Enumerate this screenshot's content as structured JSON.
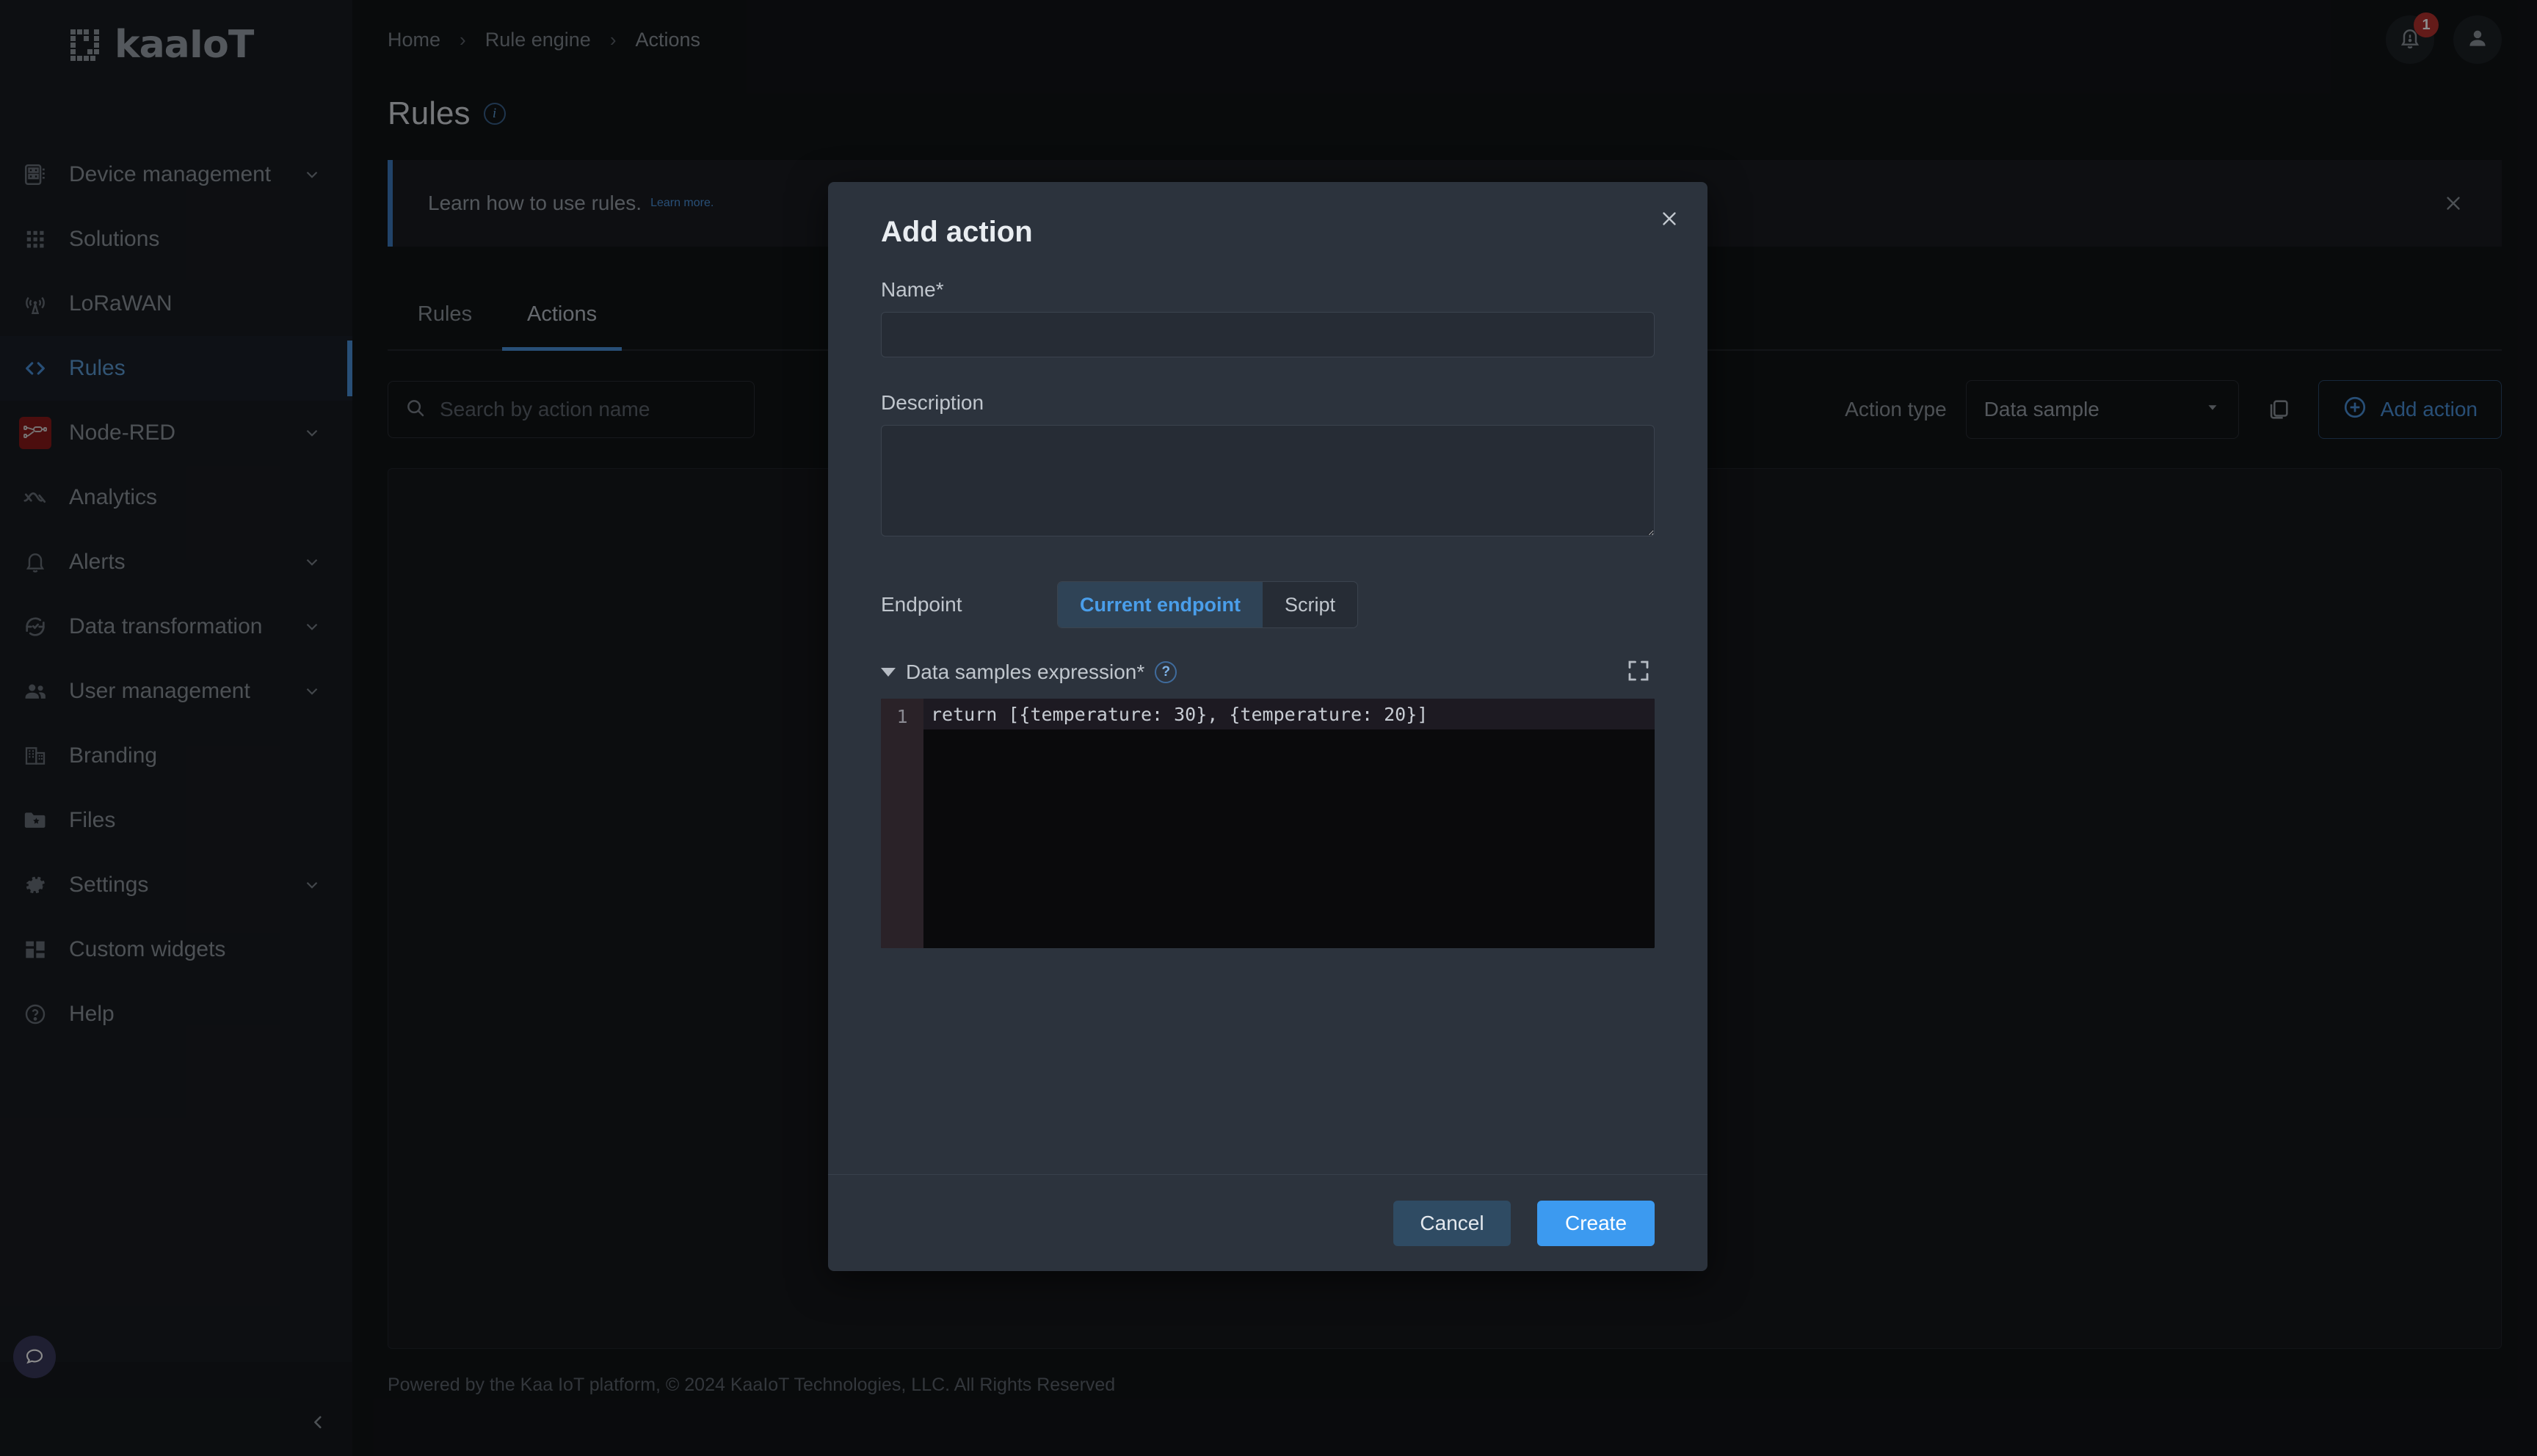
{
  "brand": {
    "name": "kaaIoT",
    "logo_icon": "kaaiot-logo-icon"
  },
  "sidebar": {
    "items": [
      {
        "label": "Device management",
        "icon": "chip-icon",
        "chevron": true,
        "active": false
      },
      {
        "label": "Solutions",
        "icon": "grid-icon",
        "chevron": false,
        "active": false
      },
      {
        "label": "LoRaWAN",
        "icon": "antenna-icon",
        "chevron": false,
        "active": false
      },
      {
        "label": "Rules",
        "icon": "code-brackets-icon",
        "chevron": false,
        "active": true
      },
      {
        "label": "Node-RED",
        "icon": "node-red-icon",
        "chevron": true,
        "active": false
      },
      {
        "label": "Analytics",
        "icon": "analytics-wave-icon",
        "chevron": false,
        "active": false
      },
      {
        "label": "Alerts",
        "icon": "bell-icon",
        "chevron": true,
        "active": false
      },
      {
        "label": "Data transformation",
        "icon": "refresh-check-icon",
        "chevron": true,
        "active": false
      },
      {
        "label": "User management",
        "icon": "users-icon",
        "chevron": true,
        "active": false
      },
      {
        "label": "Branding",
        "icon": "building-icon",
        "chevron": false,
        "active": false
      },
      {
        "label": "Files",
        "icon": "folder-star-icon",
        "chevron": false,
        "active": false
      },
      {
        "label": "Settings",
        "icon": "gear-icon",
        "chevron": true,
        "active": false
      },
      {
        "label": "Custom widgets",
        "icon": "widgets-icon",
        "chevron": false,
        "active": false
      },
      {
        "label": "Help",
        "icon": "question-circle-icon",
        "chevron": false,
        "active": false
      }
    ],
    "chat_icon": "chat-bubble-icon",
    "collapse_icon": "chevron-left-icon"
  },
  "header": {
    "breadcrumbs": [
      {
        "label": "Home"
      },
      {
        "label": "Rule engine"
      },
      {
        "label": "Actions"
      }
    ],
    "separator": "›",
    "notifications": {
      "icon": "bell-alert-icon",
      "count": "1"
    },
    "account": {
      "icon": "user-avatar-icon"
    }
  },
  "page": {
    "title": "Rules",
    "info_icon": "info-circle-icon"
  },
  "banner": {
    "text": "Learn how to use rules.",
    "link": "Learn more.",
    "close_icon": "close-icon",
    "accent_color": "#3c7bbf"
  },
  "tabs": [
    {
      "label": "Rules",
      "active": false
    },
    {
      "label": "Actions",
      "active": true
    }
  ],
  "toolbar": {
    "search": {
      "placeholder": "Search by action name",
      "value": "",
      "icon": "search-icon"
    },
    "action_type_label": "Action type",
    "action_type_value": "Data sample",
    "action_type_caret": "chevron-down-icon",
    "copy_icon": "copy-icon",
    "add_action_label": "Add action",
    "add_action_icon": "plus-circle-icon",
    "accent_color": "#4a90d9"
  },
  "modal": {
    "title": "Add action",
    "close_icon": "close-icon",
    "name_label": "Name*",
    "name_value": "",
    "description_label": "Description",
    "description_value": "",
    "endpoint_label": "Endpoint",
    "endpoint_options": [
      {
        "label": "Current endpoint",
        "active": true
      },
      {
        "label": "Script",
        "active": false
      }
    ],
    "expression_label": "Data samples expression*",
    "expression_help_icon": "question-help-icon",
    "expression_collapse_icon": "triangle-down-icon",
    "fullscreen_icon": "fullscreen-expand-icon",
    "editor": {
      "line_number": "1",
      "code": "return [{temperature: 30}, {temperature: 20}]"
    },
    "cancel_label": "Cancel",
    "create_label": "Create"
  },
  "footer": {
    "text": "Powered by the Kaa IoT platform, © 2024 KaaIoT Technologies, LLC. All Rights Reserved"
  }
}
